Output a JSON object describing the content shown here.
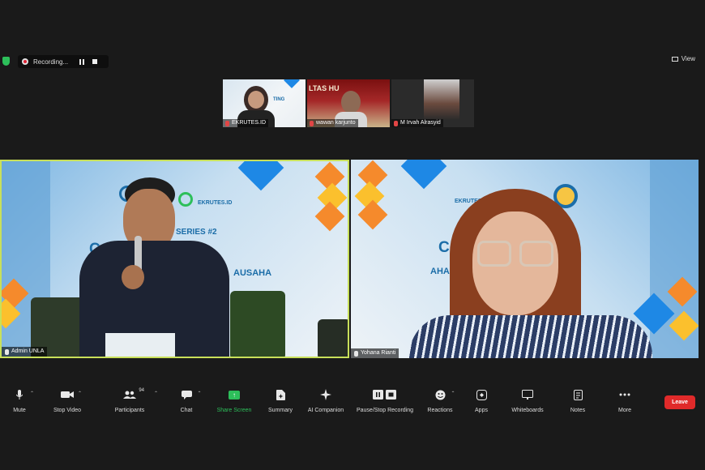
{
  "topbar": {
    "recording_label": "Recording...",
    "view_label": "View"
  },
  "thumbnails": [
    {
      "name": "EKRUTES.ID"
    },
    {
      "name": "wawan karjunto"
    },
    {
      "name": "M Irvah Alrasyid"
    }
  ],
  "thumb_texts": {
    "t1_banner": "TING",
    "t2_banner": "LTAS HU"
  },
  "videos": [
    {
      "name": "Admin UNLA",
      "brand": "EKRUTES.ID",
      "series": "SERIES #2",
      "headline": "C     TTING",
      "subline": "AUSAHA"
    },
    {
      "name": "Yohana Rianti",
      "brand": "EKRUTES.ID",
      "headline": "CA       NG",
      "subline": "AHA  BEKER"
    }
  ],
  "toolbar": {
    "mute": "Mute",
    "stop_video": "Stop Video",
    "participants": "Participants",
    "participants_count": "94",
    "chat": "Chat",
    "share_screen": "Share Screen",
    "summary": "Summary",
    "ai_companion": "AI Companion",
    "pause_stop": "Pause/Stop Recording",
    "reactions": "Reactions",
    "apps": "Apps",
    "whiteboards": "Whiteboards",
    "notes": "Notes",
    "more": "More",
    "leave": "Leave"
  },
  "colors": {
    "active_speaker_border": "#c8e05a",
    "share_green": "#2dbf5a",
    "leave_red": "#e02a2a"
  }
}
